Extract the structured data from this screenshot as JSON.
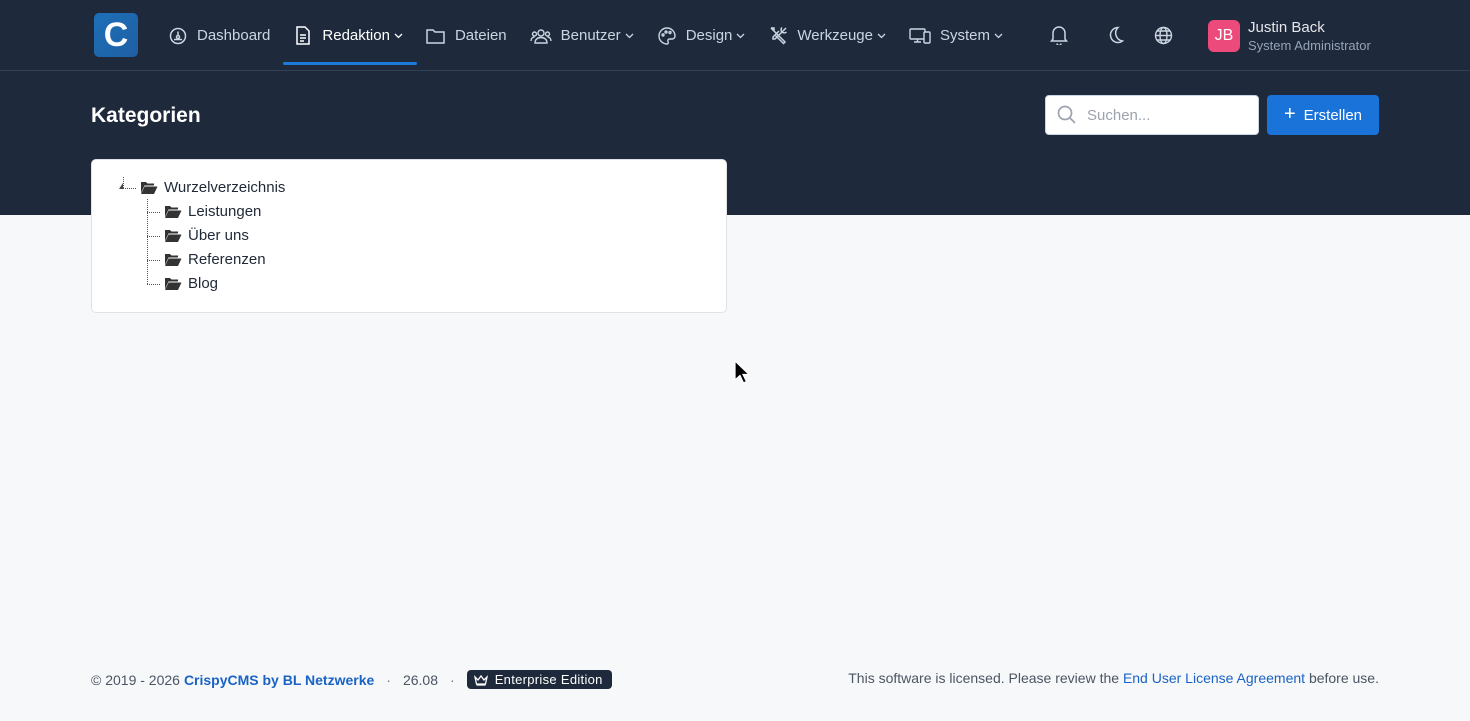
{
  "app": {
    "logo_letter": "C",
    "brand_color": "#1e6fb8"
  },
  "nav": {
    "items": [
      {
        "label": "Dashboard",
        "icon": "dashboard-gauge-icon",
        "has_caret": false
      },
      {
        "label": "Redaktion",
        "icon": "document-icon",
        "has_caret": true,
        "active": true
      },
      {
        "label": "Dateien",
        "icon": "folder-icon",
        "has_caret": false
      },
      {
        "label": "Benutzer",
        "icon": "users-icon",
        "has_caret": true
      },
      {
        "label": "Design",
        "icon": "palette-icon",
        "has_caret": true
      },
      {
        "label": "Werkzeuge",
        "icon": "tools-icon",
        "has_caret": true
      },
      {
        "label": "System",
        "icon": "devices-icon",
        "has_caret": true
      }
    ],
    "right_icons": [
      "bell-icon",
      "moon-icon",
      "globe-icon"
    ]
  },
  "user": {
    "initials": "JB",
    "name": "Justin Back",
    "role": "System Administrator",
    "avatar_color": "#ec4a7a"
  },
  "page": {
    "title": "Kategorien"
  },
  "search": {
    "placeholder": "Suchen...",
    "value": ""
  },
  "create_button": {
    "label": "Erstellen"
  },
  "tree": {
    "root": "Wurzelverzeichnis",
    "children": [
      "Leistungen",
      "Über uns",
      "Referenzen",
      "Blog"
    ]
  },
  "footer": {
    "copyright": "© 2019 - 2026",
    "company_link": "CrispyCMS by BL Netzwerke",
    "version": "26.08",
    "edition": "Enterprise Edition",
    "license_prefix": "This software is licensed. Please review the",
    "license_link": "End User License Agreement",
    "license_suffix": "before use."
  }
}
